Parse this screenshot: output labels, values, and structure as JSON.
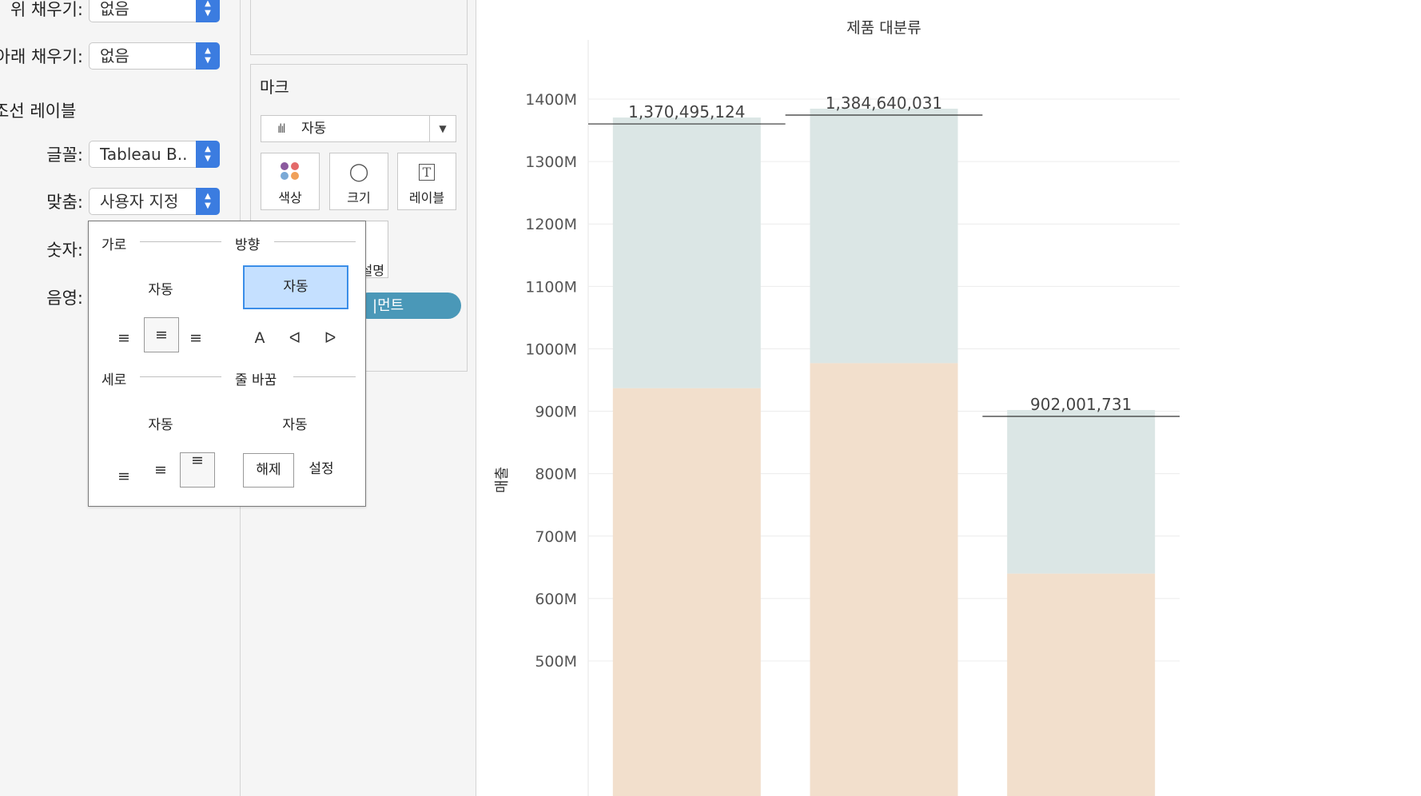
{
  "format_pane": {
    "fill_above": {
      "label": "위 채우기:",
      "value": "없음"
    },
    "fill_below": {
      "label": "아래 채우기:",
      "value": "없음"
    },
    "section_title": "조선 레이블",
    "font": {
      "label": "글꼴:",
      "value": "Tableau B.."
    },
    "alignment": {
      "label": "맞춤:",
      "value": "사용자 지정"
    },
    "numbers": {
      "label": "숫자:"
    },
    "shading": {
      "label": "음영:"
    }
  },
  "marks_card": {
    "title": "마크",
    "mark_type": "자동",
    "buttons": [
      {
        "label": "색상",
        "icon": "color-dots-icon"
      },
      {
        "label": "크기",
        "icon": "size-circles-icon"
      },
      {
        "label": "레이블",
        "icon": "text-label-icon"
      }
    ],
    "partial_tooltip_label": "설명",
    "pill_label": "|먼트",
    "colors": {
      "pill": "#4a98b8",
      "dot1": "#8b5a9e",
      "dot2": "#e46a6a",
      "dot3": "#7aa9d6",
      "dot4": "#f0a05a"
    }
  },
  "alignment_popup": {
    "horizontal": {
      "heading": "가로",
      "value": "자동"
    },
    "direction": {
      "heading": "방향",
      "value": "자동"
    },
    "vertical": {
      "heading": "세로",
      "value": "자동"
    },
    "wrap": {
      "heading": "줄 바꿈",
      "value": "자동",
      "off": "해제",
      "on": "설정"
    },
    "icons": {
      "h_left": "≡",
      "h_center": "≡",
      "h_right": "≡",
      "dir_horizontal": "A",
      "dir_up": "ᐊ",
      "dir_down": "ᐅ",
      "v_bottom": "≡",
      "v_middle": "≡",
      "v_top": "≡"
    },
    "selected_color": "#c5e0ff"
  },
  "chart_data": {
    "type": "bar",
    "stacked": true,
    "title": "제품 대분류",
    "ylabel": "매출",
    "ylim": [
      430000000,
      1480000000
    ],
    "y_ticks": [
      "500M",
      "600M",
      "700M",
      "800M",
      "900M",
      "1000M",
      "1100M",
      "1200M",
      "1300M",
      "1400M"
    ],
    "y_tick_values": [
      500000000,
      600000000,
      700000000,
      800000000,
      900000000,
      1000000000,
      1100000000,
      1200000000,
      1300000000,
      1400000000
    ],
    "categories": [
      "",
      "",
      ""
    ],
    "series": [
      {
        "values": [
          937000000,
          977000000,
          640000000
        ],
        "color": "#f2dfcc"
      },
      {
        "values": [
          433495124,
          407640031,
          262001731
        ],
        "color": "#dbe6e5"
      }
    ],
    "total_labels": [
      "1,370,495,124",
      "1,384,640,031",
      "902,001,731"
    ],
    "totals": [
      1370495124,
      1384640031,
      902001731
    ],
    "grid": true
  }
}
